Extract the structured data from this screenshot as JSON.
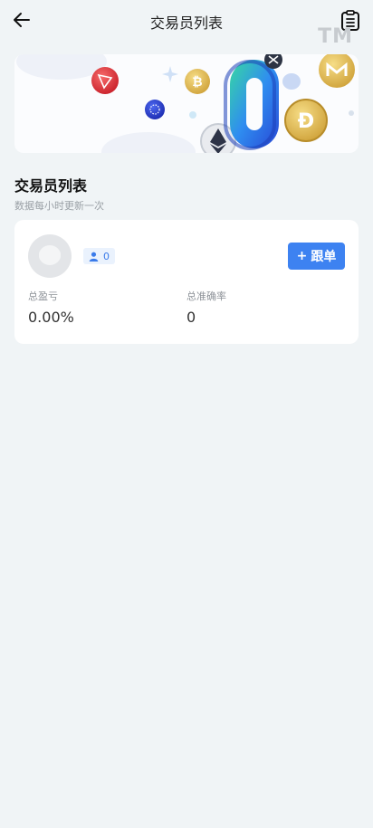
{
  "header": {
    "title": "交易员列表",
    "back_icon": "arrow-left-icon",
    "action_icon": "clipboard-list-icon",
    "watermark": "TM"
  },
  "banner": {
    "description_icons": [
      "tron-coin-icon",
      "bitcoin-coin-icon",
      "cardano-coin-icon",
      "ripple-coin-icon",
      "ethereum-coin-icon",
      "dogecoin-coin-icon",
      "monero-coin-icon",
      "zero-digit-graphic"
    ],
    "zero_text": "0"
  },
  "section": {
    "title": "交易员列表",
    "subtitle": "数据每小时更新一次"
  },
  "traders": [
    {
      "followers": "0",
      "follow_label": "跟单",
      "follow_plus": "+",
      "total_pnl_label": "总盈亏",
      "total_pnl_value": "0.00%",
      "accuracy_label": "总准确率",
      "accuracy_value": "0"
    }
  ],
  "colors": {
    "accent": "#3d82f1",
    "background": "#f0f4f6",
    "card": "#ffffff"
  }
}
